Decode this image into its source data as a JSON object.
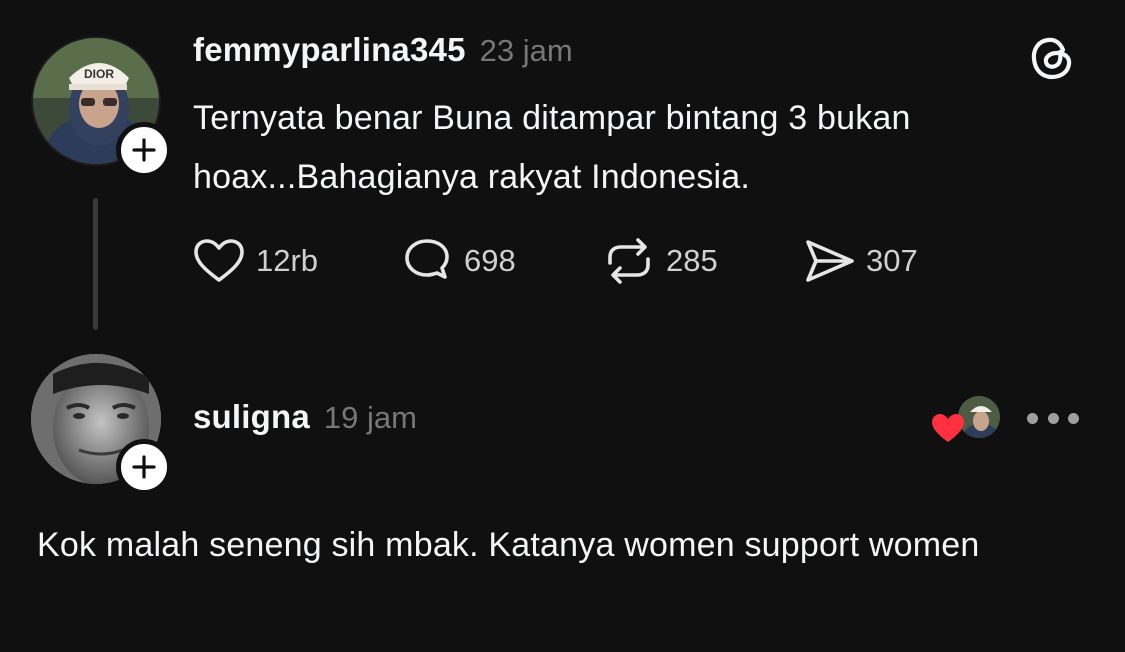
{
  "post": {
    "username": "femmyparlina345",
    "time": "23 jam",
    "text": "Ternyata benar Buna ditampar bintang 3 bukan hoax...Bahagianya rakyat Indonesia.",
    "likes": "12rb",
    "replies": "698",
    "reposts": "285",
    "shares": "307",
    "avatar_cap_text": "DIOR"
  },
  "reply": {
    "username": "suligna",
    "time": "19 jam",
    "text": "Kok malah seneng sih mbak. Katanya women support women"
  },
  "icons": {
    "follow": "plus-icon",
    "app": "threads-logo-icon",
    "like": "heart-outline-icon",
    "reply": "speech-bubble-icon",
    "repost": "repost-arrows-icon",
    "share": "paper-plane-icon",
    "liked_by_author": "heart-filled-icon",
    "more": "ellipsis-icon"
  },
  "colors": {
    "background": "#101010",
    "text": "#f3f5f7",
    "muted": "#777777",
    "heart_red": "#ff3040"
  }
}
